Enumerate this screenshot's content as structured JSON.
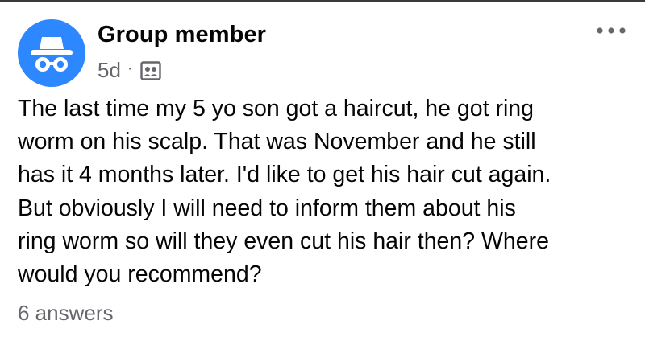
{
  "post": {
    "author": "Group member",
    "author_icon": "anonymous-member-icon",
    "timestamp": "5d",
    "separator": "·",
    "privacy_icon": "group-members-icon",
    "more_icon": "more-options-icon",
    "body": "The last time my 5 yo son got a haircut, he got ring\nworm on his scalp. That was November and he still\nhas it 4 months later. I'd like to get his hair cut again.\nBut obviously I will need to inform them about his\nring worm so will they even cut his hair then? Where\nwould you recommend?",
    "answers_label": "6 answers"
  },
  "colors": {
    "avatar_background": "#2d88ff",
    "primary_text": "#050505",
    "secondary_text": "#65676b"
  }
}
